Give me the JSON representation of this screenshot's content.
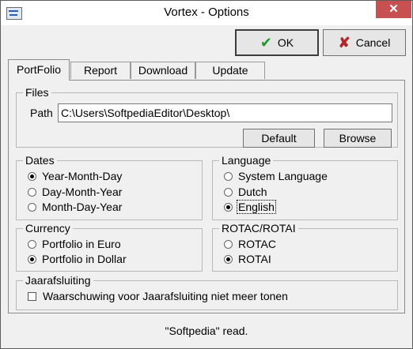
{
  "window": {
    "title": "Vortex - Options",
    "close_glyph": "✕"
  },
  "toolbar": {
    "ok_label": "OK",
    "cancel_label": "Cancel",
    "ok_icon": "check-icon",
    "cancel_icon": "x-icon"
  },
  "tabs": [
    {
      "label": "PortFolio",
      "active": true
    },
    {
      "label": "Report",
      "active": false
    },
    {
      "label": "Download",
      "active": false
    },
    {
      "label": "Update",
      "active": false
    }
  ],
  "files": {
    "group_label": "Files",
    "path_label": "Path",
    "path_value": "C:\\Users\\SoftpediaEditor\\Desktop\\",
    "default_label": "Default",
    "browse_label": "Browse"
  },
  "dates": {
    "group_label": "Dates",
    "options": [
      "Year-Month-Day",
      "Day-Month-Year",
      "Month-Day-Year"
    ],
    "selected": "Year-Month-Day"
  },
  "language": {
    "group_label": "Language",
    "options": [
      "System Language",
      "Dutch",
      "English"
    ],
    "selected": "English"
  },
  "currency": {
    "group_label": "Currency",
    "options": [
      "Portfolio in Euro",
      "Portfolio in Dollar"
    ],
    "selected": "Portfolio in Dollar"
  },
  "rotac": {
    "group_label": "ROTAC/ROTAI",
    "options": [
      "ROTAC",
      "ROTAI"
    ],
    "selected": "ROTAI"
  },
  "jaarafsluiting": {
    "group_label": "Jaarafsluiting",
    "checkbox_label": "Waarschuwing voor Jaarafsluiting niet meer tonen",
    "checked": false
  },
  "status": {
    "text": "\"Softpedia\" read."
  },
  "colors": {
    "close_button": "#c75050",
    "ok_check": "#1f9a2a",
    "cancel_x": "#b2272a"
  }
}
